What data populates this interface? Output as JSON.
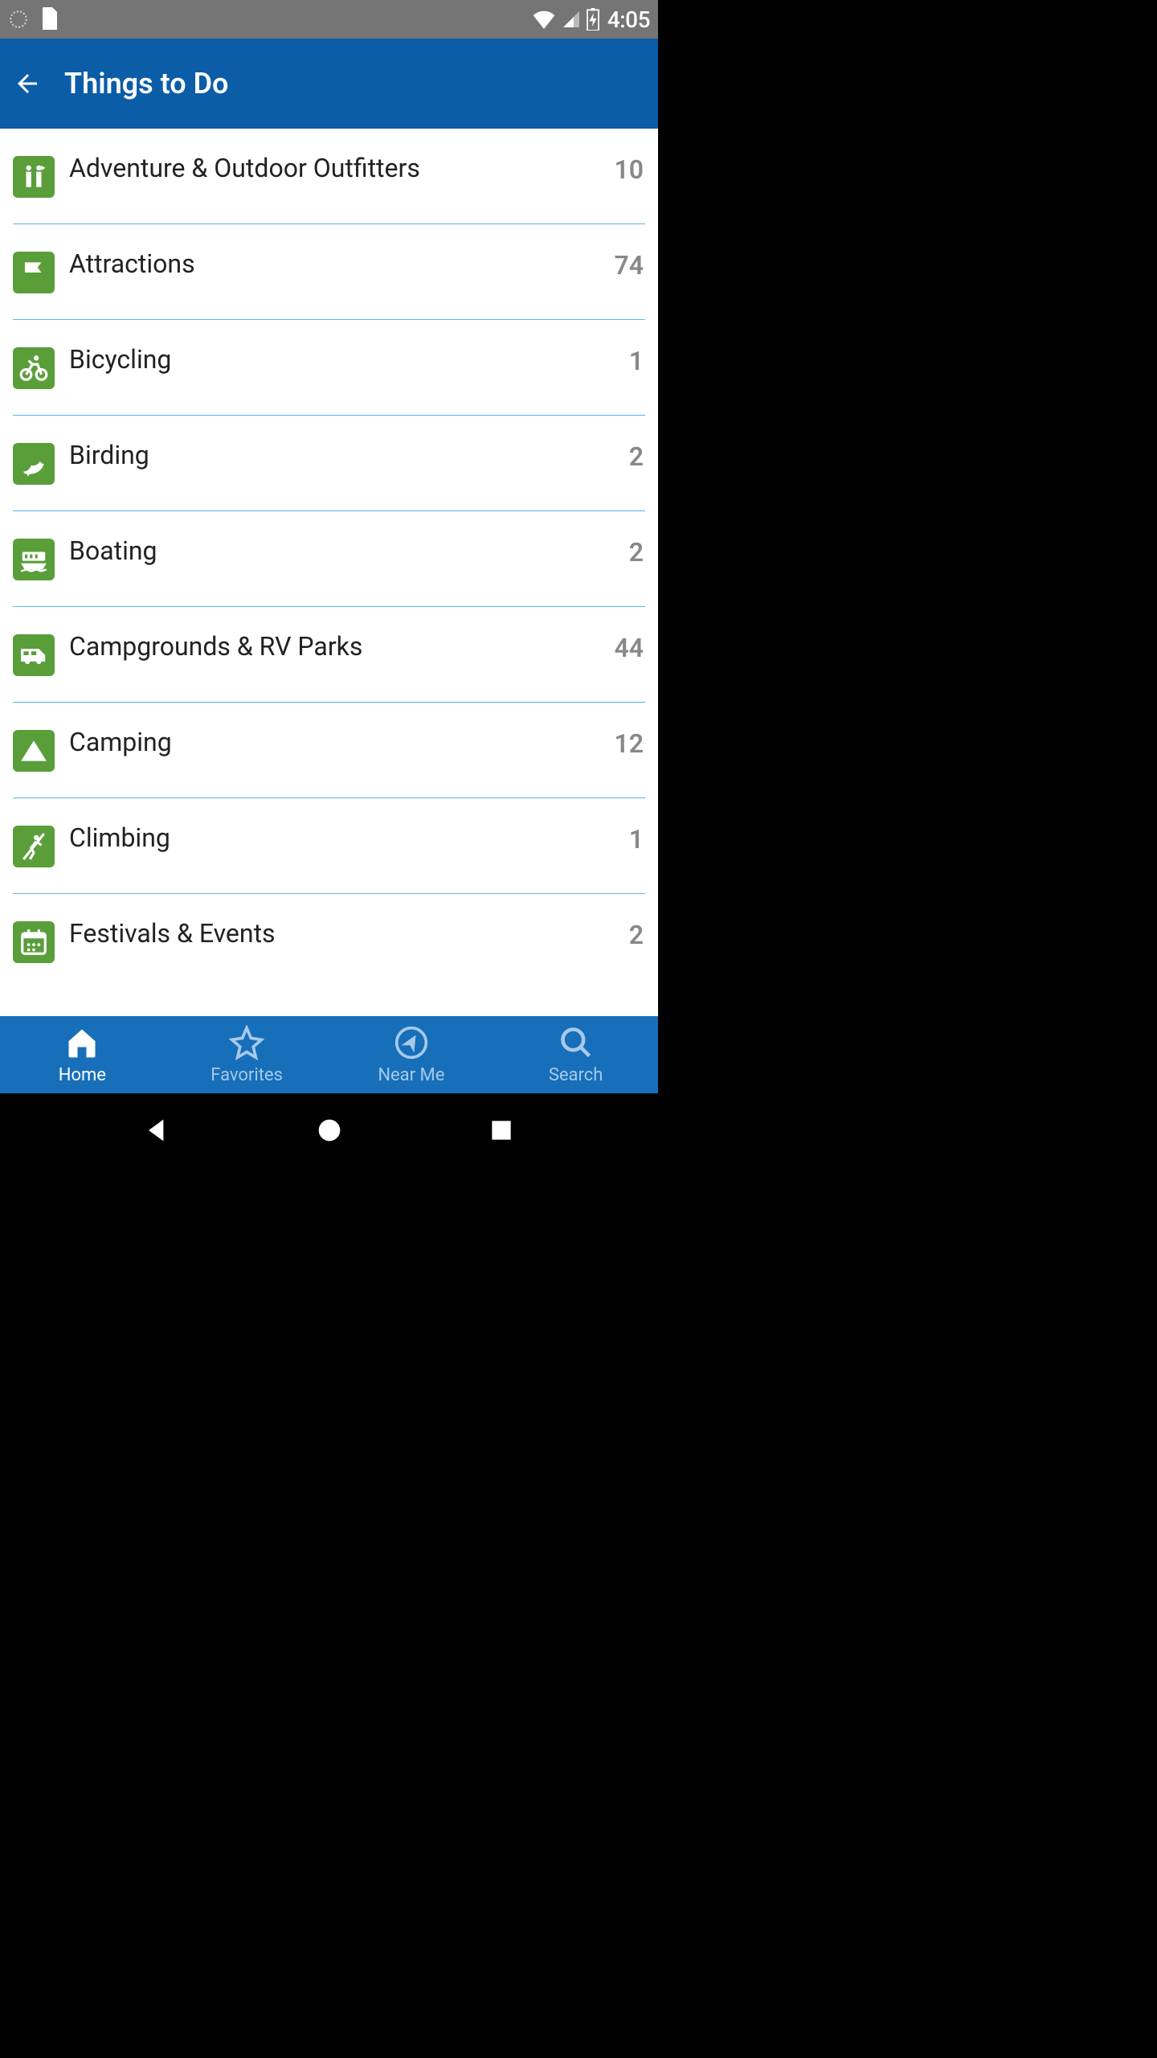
{
  "status": {
    "time": "4:05"
  },
  "app_bar": {
    "title": "Things to Do"
  },
  "categories": [
    {
      "name": "Adventure & Outdoor Outfitters",
      "count": "10",
      "icon": "outfitters"
    },
    {
      "name": "Attractions",
      "count": "74",
      "icon": "flag"
    },
    {
      "name": "Bicycling",
      "count": "1",
      "icon": "bike"
    },
    {
      "name": "Birding",
      "count": "2",
      "icon": "bird"
    },
    {
      "name": "Boating",
      "count": "2",
      "icon": "boat"
    },
    {
      "name": "Campgrounds & RV Parks",
      "count": "44",
      "icon": "rv"
    },
    {
      "name": "Camping",
      "count": "12",
      "icon": "tent"
    },
    {
      "name": "Climbing",
      "count": "1",
      "icon": "climb"
    },
    {
      "name": "Festivals & Events",
      "count": "2",
      "icon": "calendar"
    }
  ],
  "tabs": [
    {
      "label": "Home",
      "icon": "home",
      "active": true
    },
    {
      "label": "Favorites",
      "icon": "star",
      "active": false
    },
    {
      "label": "Near Me",
      "icon": "compass",
      "active": false
    },
    {
      "label": "Search",
      "icon": "search",
      "active": false
    }
  ]
}
